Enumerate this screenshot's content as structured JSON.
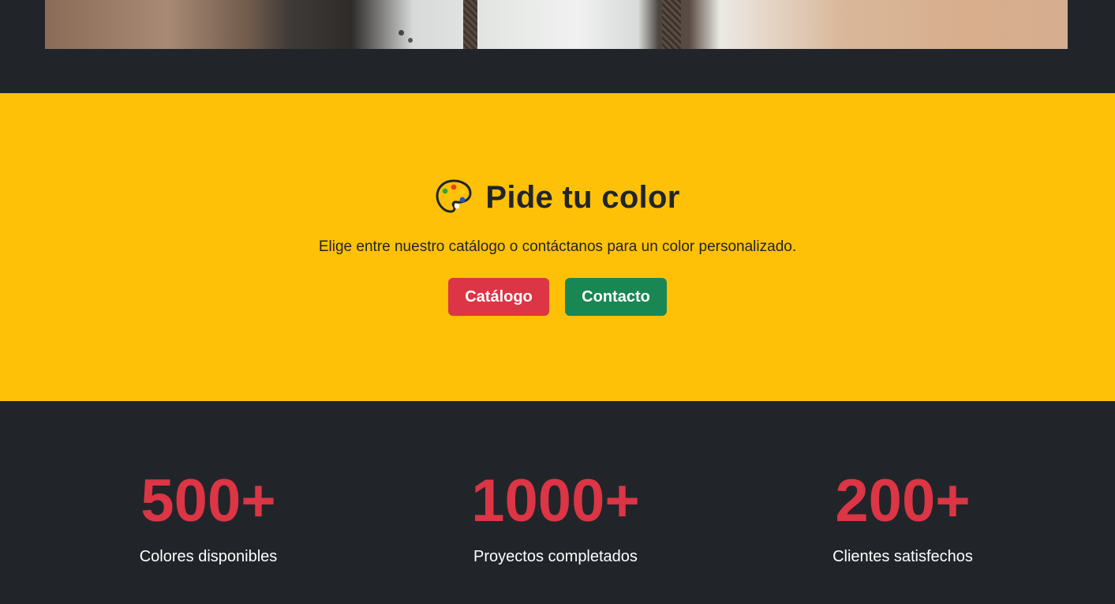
{
  "cta": {
    "icon": "artist-palette-icon",
    "title": "Pide tu color",
    "subtitle": "Elige entre nuestro catálogo o contáctanos para un color personalizado.",
    "buttons": [
      {
        "label": "Catálogo",
        "color": "#dc3545"
      },
      {
        "label": "Contacto",
        "color": "#198754"
      }
    ],
    "background": "#ffc107"
  },
  "stats": [
    {
      "value": "500+",
      "label": "Colores disponibles"
    },
    {
      "value": "1000+",
      "label": "Proyectos completados"
    },
    {
      "value": "200+",
      "label": "Clientes satisfechos"
    }
  ],
  "colors": {
    "dark": "#212529",
    "accent": "#dc3545"
  }
}
